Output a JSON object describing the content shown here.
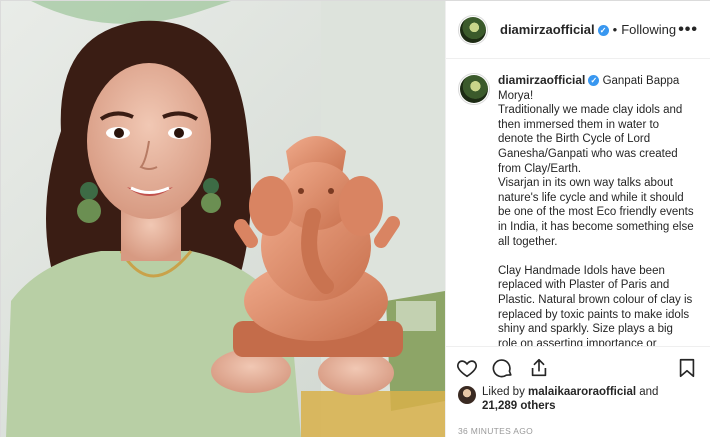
{
  "header": {
    "username": "diamirzaofficial",
    "verified": true,
    "separator": "•",
    "follow_status": "Following",
    "more_label": "•••"
  },
  "caption": {
    "username": "diamirzaofficial",
    "paragraphs": [
      "Ganpati Bappa Morya!",
      "Traditionally we made clay idols and then immersed them in water to denote the Birth Cycle of Lord Ganesha/Ganpati who was created from Clay/Earth.",
      "Visarjan in its own way talks about nature's life cycle and while it should be one of the most Eco friendly events in India, it has become something else all together.",
      "",
      "Clay Handmade Idols have been replaced with Plaster of Paris and Plastic. Natural brown colour of clay is replaced by toxic paints to make idols shiny and sparkly. Size plays a big role on asserting importance or"
    ]
  },
  "likes": {
    "prefix": "Liked by ",
    "user": "malaikaaroraofficial",
    "mid": " and",
    "count_text": "21,289 others"
  },
  "timestamp": "36 MINUTES AGO",
  "icons": {
    "like": "heart-icon",
    "comment": "comment-icon",
    "share": "share-icon",
    "save": "bookmark-icon",
    "verified": "verified-badge-icon"
  },
  "colors": {
    "verified": "#3897f0",
    "text": "#262626",
    "muted": "#999999",
    "border": "#efefef"
  }
}
